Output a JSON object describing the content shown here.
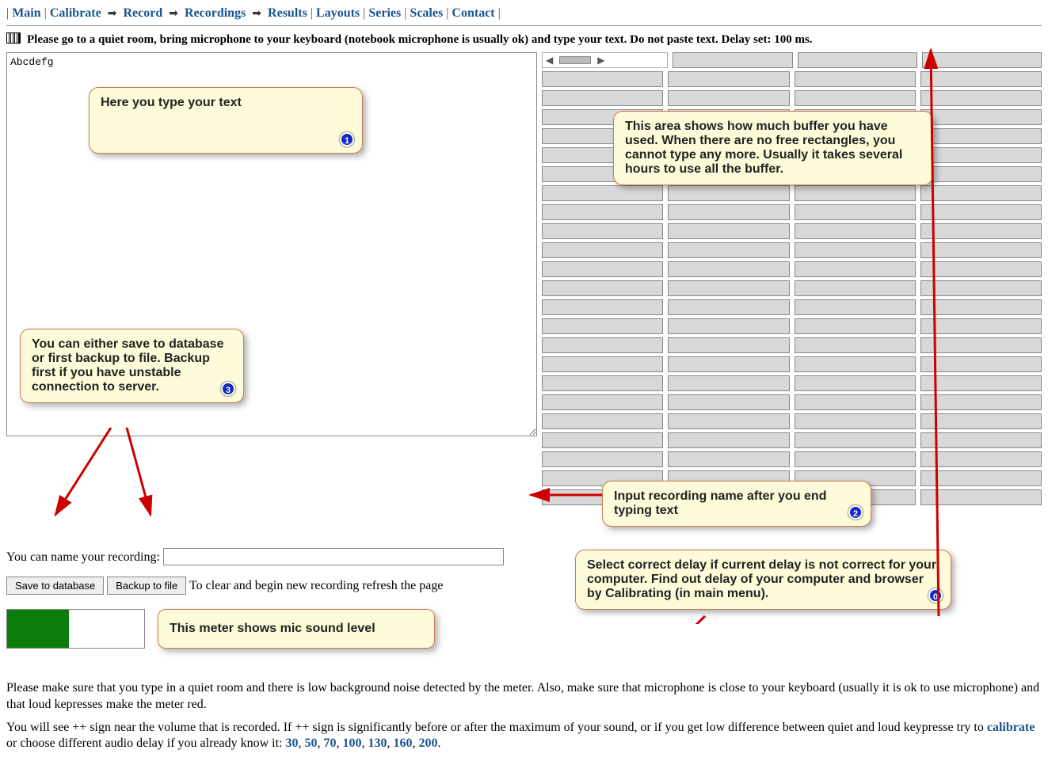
{
  "nav": {
    "main": "Main",
    "calibrate": "Calibrate",
    "record": "Record",
    "recordings": "Recordings",
    "results": "Results",
    "layouts": "Layouts",
    "series": "Series",
    "scales": "Scales",
    "contact": "Contact"
  },
  "instruction": "Please go to a quiet room, bring microphone to your keyboard (notebook microphone is usually ok) and type your text. Do not paste text. Delay set: 100 ms.",
  "textbox_value": "Abcdefg",
  "buffer": {
    "rows": 24,
    "cols": 4
  },
  "name_label": "You can name your recording:",
  "name_value": "",
  "buttons": {
    "save": "Save to database",
    "backup": "Backup to file"
  },
  "clear_hint": "To clear and begin new recording refresh the page",
  "callouts": {
    "c1": "Here you type your text",
    "c_buffer": "This area shows how much buffer you have used. When there are no free rectangles, you cannot type any more. Usually it takes several hours to use all the buffer.",
    "c3": "You can either save to database or first backup to file. Backup first if you have unstable connection to server.",
    "c_name": "Input recording name after you end typing text",
    "c_delay": "Select correct delay if current delay is not correct for your computer. Find out delay of your computer and browser by Calibrating (in main menu).",
    "c_meter": "This meter shows mic sound level"
  },
  "paragraphs": {
    "p1": "Please make sure that you type in a quiet room and there is low background noise detected by the meter. Also, make sure that microphone is close to your keyboard (usually it is ok to use microphone) and that loud kepresses make the meter red.",
    "p2_a": "You will see ++ sign near the volume that is recorded. If ++ sign is significantly before or after the maximum of your sound, or if you get low difference between quiet and loud keypresse try to ",
    "p2_calibrate": "calibrate",
    "p2_b": " or choose different audio delay if you already know it: ",
    "delays": [
      "30",
      "50",
      "70",
      "100",
      "130",
      "160",
      "200"
    ]
  }
}
